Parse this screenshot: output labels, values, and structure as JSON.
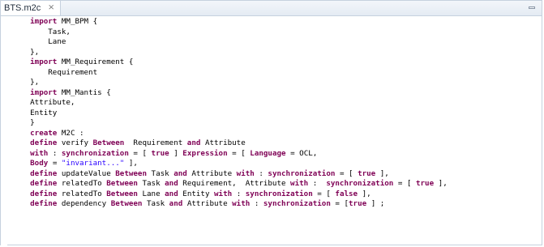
{
  "editor": {
    "tab_label": "BTS.m2c",
    "tab_close_glyph": "⨯",
    "lines": [
      {
        "indent": "    ",
        "segs": [
          {
            "k": "kw",
            "t": "import"
          },
          {
            "k": "",
            "t": " MM_BPM {"
          }
        ]
      },
      {
        "indent": "        ",
        "segs": [
          {
            "k": "",
            "t": "Task,"
          }
        ]
      },
      {
        "indent": "        ",
        "segs": [
          {
            "k": "",
            "t": "Lane"
          }
        ]
      },
      {
        "indent": "    ",
        "segs": [
          {
            "k": "",
            "t": "},"
          }
        ]
      },
      {
        "indent": "    ",
        "segs": [
          {
            "k": "kw",
            "t": "import"
          },
          {
            "k": "",
            "t": " MM_Requirement {"
          }
        ]
      },
      {
        "indent": "        ",
        "segs": [
          {
            "k": "",
            "t": "Requirement"
          }
        ]
      },
      {
        "indent": "    ",
        "segs": [
          {
            "k": "",
            "t": "},"
          }
        ]
      },
      {
        "indent": "    ",
        "segs": [
          {
            "k": "kw",
            "t": "import"
          },
          {
            "k": "",
            "t": " MM_Mantis {"
          }
        ]
      },
      {
        "indent": "    ",
        "segs": [
          {
            "k": "",
            "t": "Attribute,"
          }
        ]
      },
      {
        "indent": "    ",
        "segs": [
          {
            "k": "",
            "t": "Entity"
          }
        ]
      },
      {
        "indent": "    ",
        "segs": [
          {
            "k": "",
            "t": "}"
          }
        ]
      },
      {
        "indent": "    ",
        "segs": [
          {
            "k": "kw",
            "t": "create"
          },
          {
            "k": "",
            "t": " M2C :"
          }
        ]
      },
      {
        "indent": "    ",
        "segs": [
          {
            "k": "kw",
            "t": "define"
          },
          {
            "k": "",
            "t": " verify "
          },
          {
            "k": "kw",
            "t": "Between"
          },
          {
            "k": "",
            "t": "  Requirement "
          },
          {
            "k": "kw",
            "t": "and"
          },
          {
            "k": "",
            "t": " Attribute"
          }
        ]
      },
      {
        "indent": "    ",
        "segs": [
          {
            "k": "kw",
            "t": "with"
          },
          {
            "k": "",
            "t": " : "
          },
          {
            "k": "kw",
            "t": "synchronization"
          },
          {
            "k": "",
            "t": " = [ "
          },
          {
            "k": "kw",
            "t": "true"
          },
          {
            "k": "",
            "t": " ] "
          },
          {
            "k": "kw",
            "t": "Expression"
          },
          {
            "k": "",
            "t": " = [ "
          },
          {
            "k": "kw",
            "t": "Language"
          },
          {
            "k": "",
            "t": " = OCL,"
          }
        ]
      },
      {
        "indent": "    ",
        "segs": [
          {
            "k": "kw",
            "t": "Body"
          },
          {
            "k": "",
            "t": " = "
          },
          {
            "k": "str",
            "t": "\"invariant...\""
          },
          {
            "k": "",
            "t": " ],"
          }
        ]
      },
      {
        "indent": "    ",
        "segs": [
          {
            "k": "kw",
            "t": "define"
          },
          {
            "k": "",
            "t": " updateValue "
          },
          {
            "k": "kw",
            "t": "Between"
          },
          {
            "k": "",
            "t": " Task "
          },
          {
            "k": "kw",
            "t": "and"
          },
          {
            "k": "",
            "t": " Attribute "
          },
          {
            "k": "kw",
            "t": "with"
          },
          {
            "k": "",
            "t": " : "
          },
          {
            "k": "kw",
            "t": "synchronization"
          },
          {
            "k": "",
            "t": " = [ "
          },
          {
            "k": "kw",
            "t": "true"
          },
          {
            "k": "",
            "t": " ],"
          }
        ]
      },
      {
        "indent": "    ",
        "segs": [
          {
            "k": "kw",
            "t": "define"
          },
          {
            "k": "",
            "t": " relatedTo "
          },
          {
            "k": "kw",
            "t": "Between"
          },
          {
            "k": "",
            "t": " Task "
          },
          {
            "k": "kw",
            "t": "and"
          },
          {
            "k": "",
            "t": " Requirement,  Attribute "
          },
          {
            "k": "kw",
            "t": "with"
          },
          {
            "k": "",
            "t": " :  "
          },
          {
            "k": "kw",
            "t": "synchronization"
          },
          {
            "k": "",
            "t": " = [ "
          },
          {
            "k": "kw",
            "t": "true"
          },
          {
            "k": "",
            "t": " ],"
          }
        ]
      },
      {
        "indent": "    ",
        "segs": [
          {
            "k": "kw",
            "t": "define"
          },
          {
            "k": "",
            "t": " relatedTo "
          },
          {
            "k": "kw",
            "t": "Between"
          },
          {
            "k": "",
            "t": " Lane "
          },
          {
            "k": "kw",
            "t": "and"
          },
          {
            "k": "",
            "t": " Entity "
          },
          {
            "k": "kw",
            "t": "with"
          },
          {
            "k": "",
            "t": " : "
          },
          {
            "k": "kw",
            "t": "synchronization"
          },
          {
            "k": "",
            "t": " = [ "
          },
          {
            "k": "kw",
            "t": "false"
          },
          {
            "k": "",
            "t": " ],"
          }
        ]
      },
      {
        "indent": "    ",
        "segs": [
          {
            "k": "kw",
            "t": "define"
          },
          {
            "k": "",
            "t": " dependency "
          },
          {
            "k": "kw",
            "t": "Between"
          },
          {
            "k": "",
            "t": " Task "
          },
          {
            "k": "kw",
            "t": "and"
          },
          {
            "k": "",
            "t": " Attribute "
          },
          {
            "k": "kw",
            "t": "with"
          },
          {
            "k": "",
            "t": " : "
          },
          {
            "k": "kw",
            "t": "synchronization"
          },
          {
            "k": "",
            "t": " = ["
          },
          {
            "k": "kw",
            "t": "true"
          },
          {
            "k": "",
            "t": " ] ;"
          }
        ]
      }
    ]
  },
  "colors": {
    "keyword": "#7f0055",
    "string": "#2a00ff",
    "tab_border": "#c6d1de"
  },
  "icons": {
    "tab_close": "close-icon",
    "view_minimize": "minimize-icon"
  }
}
